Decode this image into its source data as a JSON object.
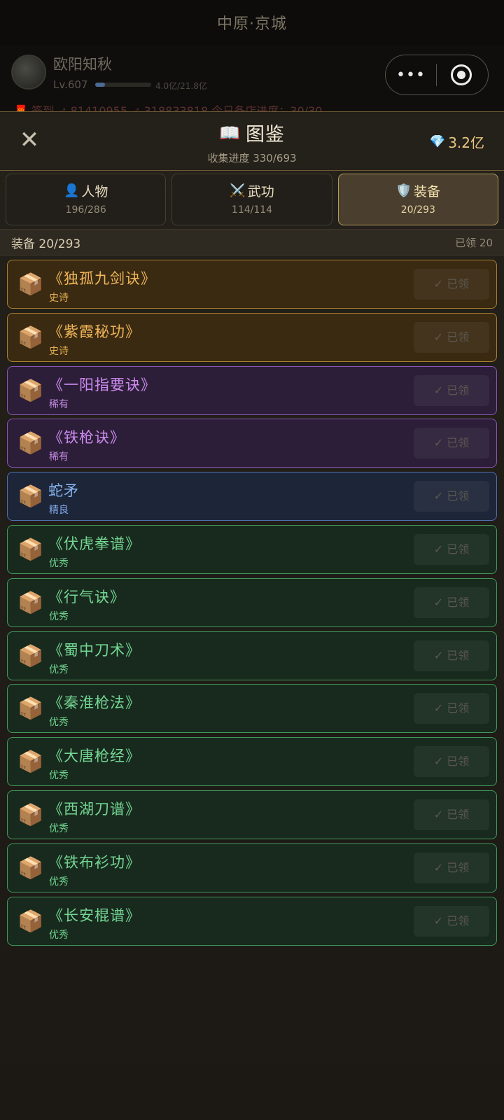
{
  "topbar": {
    "location": "中原·京城"
  },
  "player": {
    "name": "欧阳知秋",
    "level": "Lv.607",
    "xp_text": "4.0亿/21.8亿",
    "xp_fraction": 0.18,
    "strip_text": "🧧 签到  ➶ 81410955  ➶ 318833818  今日备店进度：30/30"
  },
  "capsule": {
    "more_label": "•••"
  },
  "modal": {
    "close_glyph": "✕",
    "book_icon": "📖",
    "title": "图鉴",
    "progress": "收集进度 330/693",
    "gem_icon": "💎",
    "currency": "3.2亿"
  },
  "tabs": [
    {
      "icon": "👤",
      "label": "人物",
      "count": "196/286"
    },
    {
      "icon": "⚔️",
      "label": "武功",
      "count": "114/114"
    },
    {
      "icon": "🛡️",
      "label": "装备",
      "count": "20/293"
    }
  ],
  "section": {
    "title": "装备 20/293",
    "claimed": "已领 20"
  },
  "item_icon": "📦",
  "items": [
    {
      "name": "《独孤九剑诀》",
      "quality": "史诗",
      "button": "✓ 已领"
    },
    {
      "name": "《紫霞秘功》",
      "quality": "史诗",
      "button": "✓ 已领"
    },
    {
      "name": "《一阳指要诀》",
      "quality": "稀有",
      "button": "✓ 已领"
    },
    {
      "name": "《铁枪诀》",
      "quality": "稀有",
      "button": "✓ 已领"
    },
    {
      "name": "蛇矛",
      "quality": "精良",
      "button": "✓ 已领"
    },
    {
      "name": "《伏虎拳谱》",
      "quality": "优秀",
      "button": "✓ 已领"
    },
    {
      "name": "《行气诀》",
      "quality": "优秀",
      "button": "✓ 已领"
    },
    {
      "name": "《蜀中刀术》",
      "quality": "优秀",
      "button": "✓ 已领"
    },
    {
      "name": "《秦淮枪法》",
      "quality": "优秀",
      "button": "✓ 已领"
    },
    {
      "name": "《大唐枪经》",
      "quality": "优秀",
      "button": "✓ 已领"
    },
    {
      "name": "《西湖刀谱》",
      "quality": "优秀",
      "button": "✓ 已领"
    },
    {
      "name": "《铁布衫功》",
      "quality": "优秀",
      "button": "✓ 已领"
    },
    {
      "name": "《长安棍谱》",
      "quality": "优秀",
      "button": "✓ 已领"
    }
  ]
}
